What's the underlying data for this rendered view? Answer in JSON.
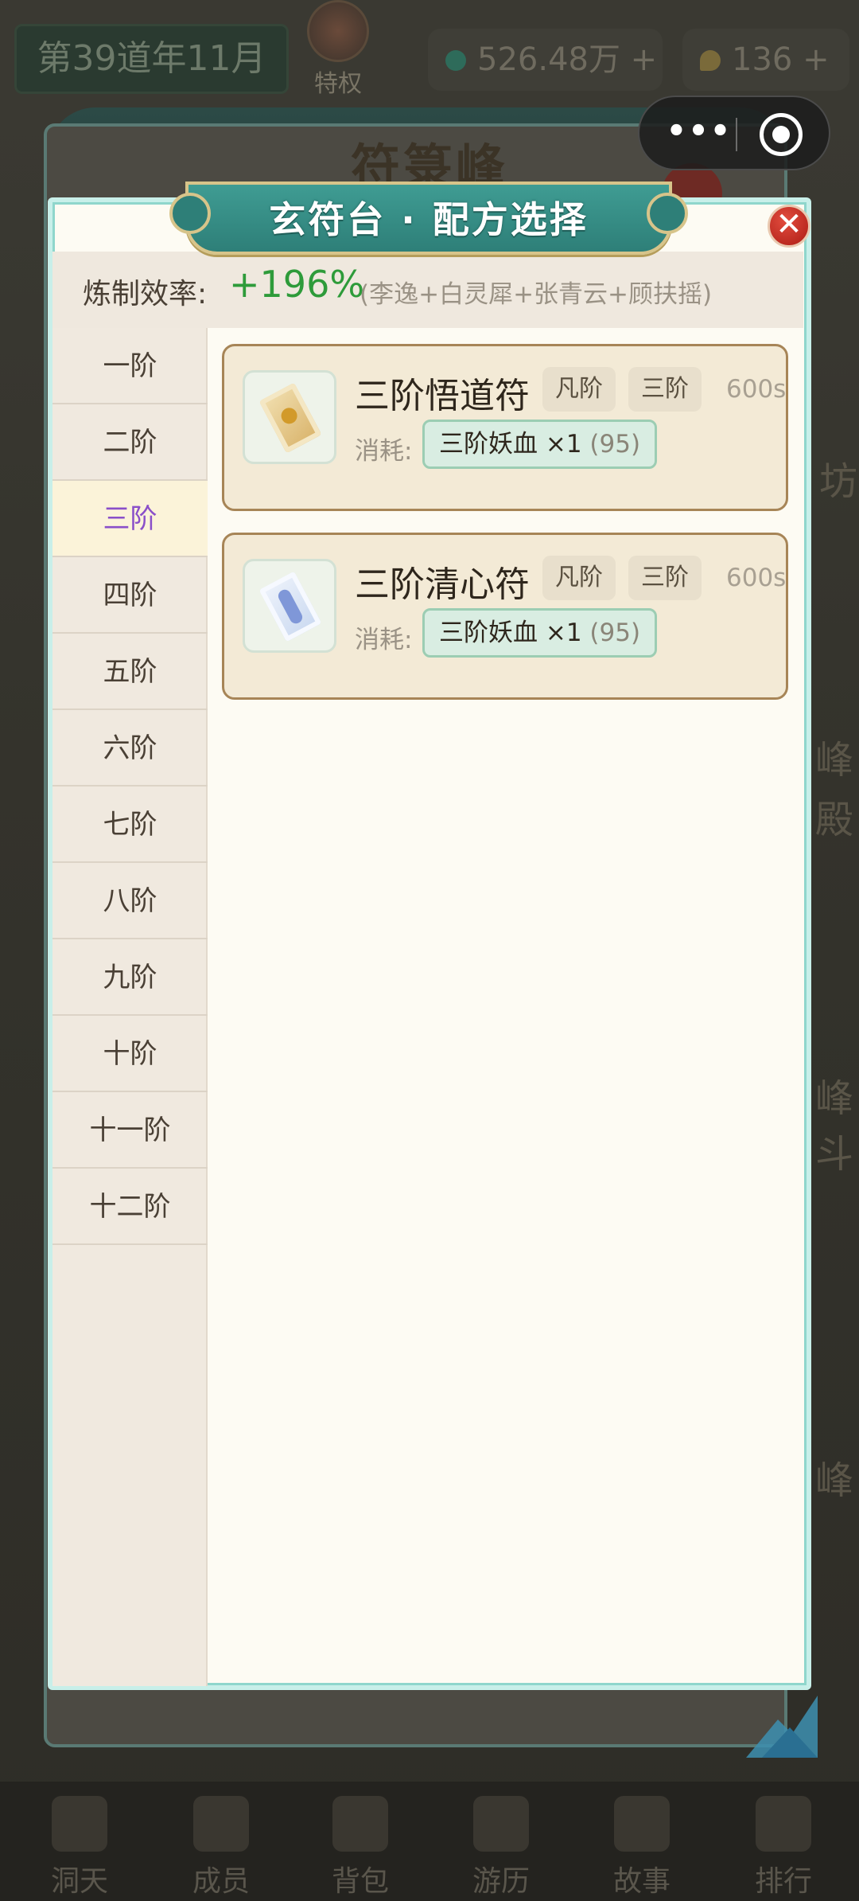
{
  "background": {
    "date": "第39道年11月",
    "privilege_label": "特权",
    "jade_amount": "526.48万 +",
    "gold_amount": "136 +",
    "old_panel_title": "符箓峰",
    "capsule_dots": "•••",
    "nav": [
      "洞天",
      "成员",
      "背包",
      "游历",
      "故事",
      "排行"
    ],
    "side_glyphs": [
      "坊",
      "峰",
      "殿",
      "峰",
      "斗",
      "峰"
    ]
  },
  "modal": {
    "title": "玄符台 · 配方选择",
    "close_label": "✕",
    "efficiency_label": "炼制效率:",
    "efficiency_value": "+196%",
    "efficiency_names": "(李逸+白灵犀+张青云+顾扶摇)"
  },
  "tiers": [
    "一阶",
    "二阶",
    "三阶",
    "四阶",
    "五阶",
    "六阶",
    "七阶",
    "八阶",
    "九阶",
    "十阶",
    "十一阶",
    "十二阶"
  ],
  "selected_tier": "三阶",
  "recipes": [
    {
      "name": "三阶悟道符",
      "icon": "gold-talisman-icon",
      "tag1": "凡阶",
      "tag2": "三阶",
      "time": "600s",
      "cost_label": "消耗:",
      "cost_item": "三阶妖血 ×1",
      "cost_owned": "(95)"
    },
    {
      "name": "三阶清心符",
      "icon": "blue-talisman-icon",
      "tag1": "凡阶",
      "tag2": "三阶",
      "time": "600s",
      "cost_label": "消耗:",
      "cost_item": "三阶妖血 ×1",
      "cost_owned": "(95)"
    }
  ],
  "colors": {
    "accent_teal": "#2e7f78",
    "efficiency_green": "#2e9b3a",
    "selected_tier_purple": "#8a4fc9",
    "close_red": "#b7261d"
  }
}
